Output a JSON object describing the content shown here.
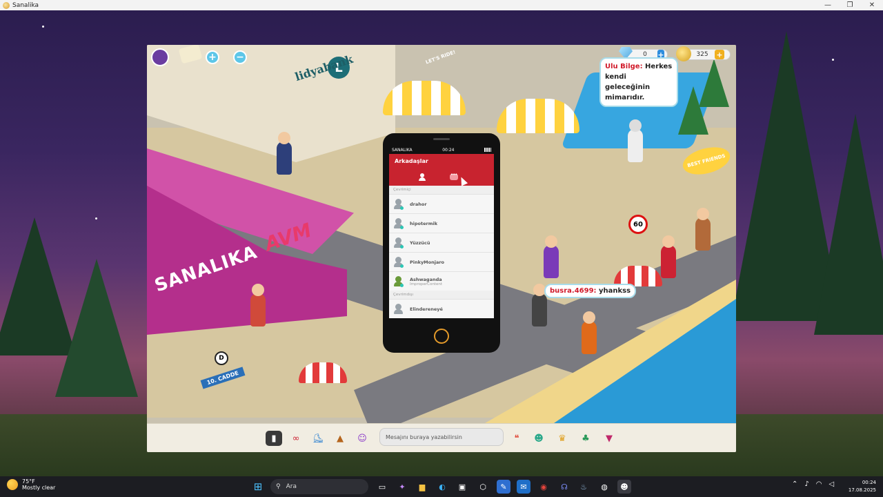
{
  "window": {
    "title": "Sanalika",
    "minimize": "—",
    "maximize": "❐",
    "close": "✕"
  },
  "scene_labels": {
    "bank_name": "lidyabank",
    "bank_letter": "L",
    "mall_name": "SANALIKA",
    "mall_avm": "AVM",
    "street_sign": "10. CADDE",
    "speed_sign": "60",
    "zone_sign": "D",
    "best_friends_sign": "BEST FRIENDS",
    "lets_ride": "LET'S RIDE!"
  },
  "hud": {
    "zoom_in": "+",
    "zoom_out": "−",
    "gems": {
      "value": "0",
      "plus": "+"
    },
    "coins": {
      "value": "325",
      "plus": "+"
    }
  },
  "bubbles": {
    "npc": {
      "name": "Ulu Bilge:",
      "text": " Herkes kendi geleceğinin mimarıdır."
    },
    "player": {
      "name": "busra.4699:",
      "text": " yhankss"
    }
  },
  "phone": {
    "carrier": "SANALIKA",
    "time": "00:24",
    "title": "Arkadaşlar",
    "online_label": "Çevrimiçi",
    "offline_label": "Çevrimdışı",
    "friends_online": [
      {
        "name": "drahor",
        "sub": ""
      },
      {
        "name": "hipotermik",
        "sub": ""
      },
      {
        "name": "Yüzzücü",
        "sub": ""
      },
      {
        "name": "PinkyMonjaro",
        "sub": ""
      },
      {
        "name": "Ashwaganda",
        "sub": "ImproperContent"
      }
    ],
    "friends_offline": [
      {
        "name": "Elindereneyé",
        "sub": ""
      }
    ]
  },
  "gamebar": {
    "chat_placeholder": "Mesajını buraya yazabilirsin",
    "tools_left": [
      "phone-icon",
      "glasses-icon",
      "skateboard-icon",
      "bag-icon",
      "dance-icon"
    ],
    "tools_right": [
      "chat-bubbles-icon",
      "emoji-icon",
      "trophy-icon",
      "island-icon",
      "gem-shop-icon"
    ]
  },
  "taskbar": {
    "weather_temp": "75°F",
    "weather_cond": "Mostly clear",
    "search_label": "Ara",
    "clock_time": "00:24",
    "clock_date": "17.08.2025"
  },
  "colors": {
    "accent_red": "#c8232f",
    "mall_pink": "#b42f8c",
    "sea_blue": "#2a9ad6",
    "online_dot": "#2dc6b5"
  }
}
